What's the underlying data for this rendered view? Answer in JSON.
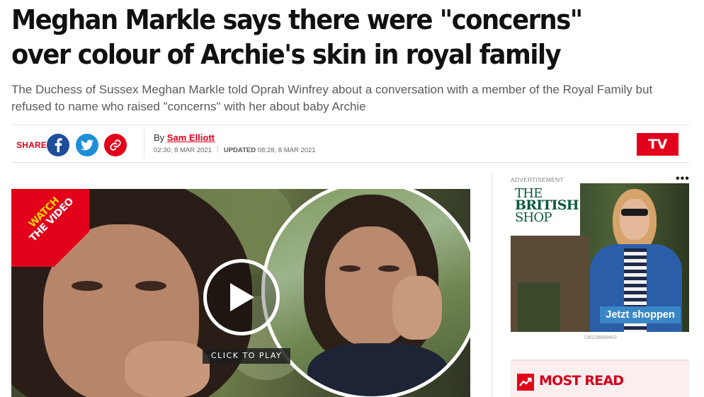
{
  "article": {
    "headline": "Meghan Markle says there were \"concerns\" over colour of Archie's skin in royal family",
    "standfirst": "The Duchess of Sussex Meghan Markle told Oprah Winfrey about a conversation with a member of the Royal Family but refused to name who raised \"concerns\" with her about baby Archie"
  },
  "share": {
    "label": "SHARE",
    "icons": [
      "facebook-icon",
      "twitter-icon",
      "link-icon"
    ],
    "colors": {
      "facebook": "#1e4d9a",
      "twitter": "#1d8fd8",
      "link": "#e2001a"
    }
  },
  "byline": {
    "prefix": "By",
    "author": "Sam Elliott",
    "published": "02:30, 8 MAR 2021",
    "updated_label": "UPDATED",
    "updated": "08:28, 8 MAR 2021"
  },
  "tv_button": {
    "label": "TV"
  },
  "video": {
    "badge_line1": "WATCH",
    "badge_line2": "THE VIDEO",
    "play_label": "CLICK TO PLAY"
  },
  "ad": {
    "label": "ADVERTISEMENT",
    "menu": "•••",
    "brand_line1": "THE",
    "brand_line2": "BRITISH",
    "brand_line3": "SHOP",
    "cta": "Jetzt shoppen",
    "id": "136238889453"
  },
  "most_read": {
    "label": "MOST READ"
  },
  "theme": {
    "accent": "#e2001a",
    "badge_yellow": "#ffd200",
    "brand_green": "#0d5b3d"
  }
}
